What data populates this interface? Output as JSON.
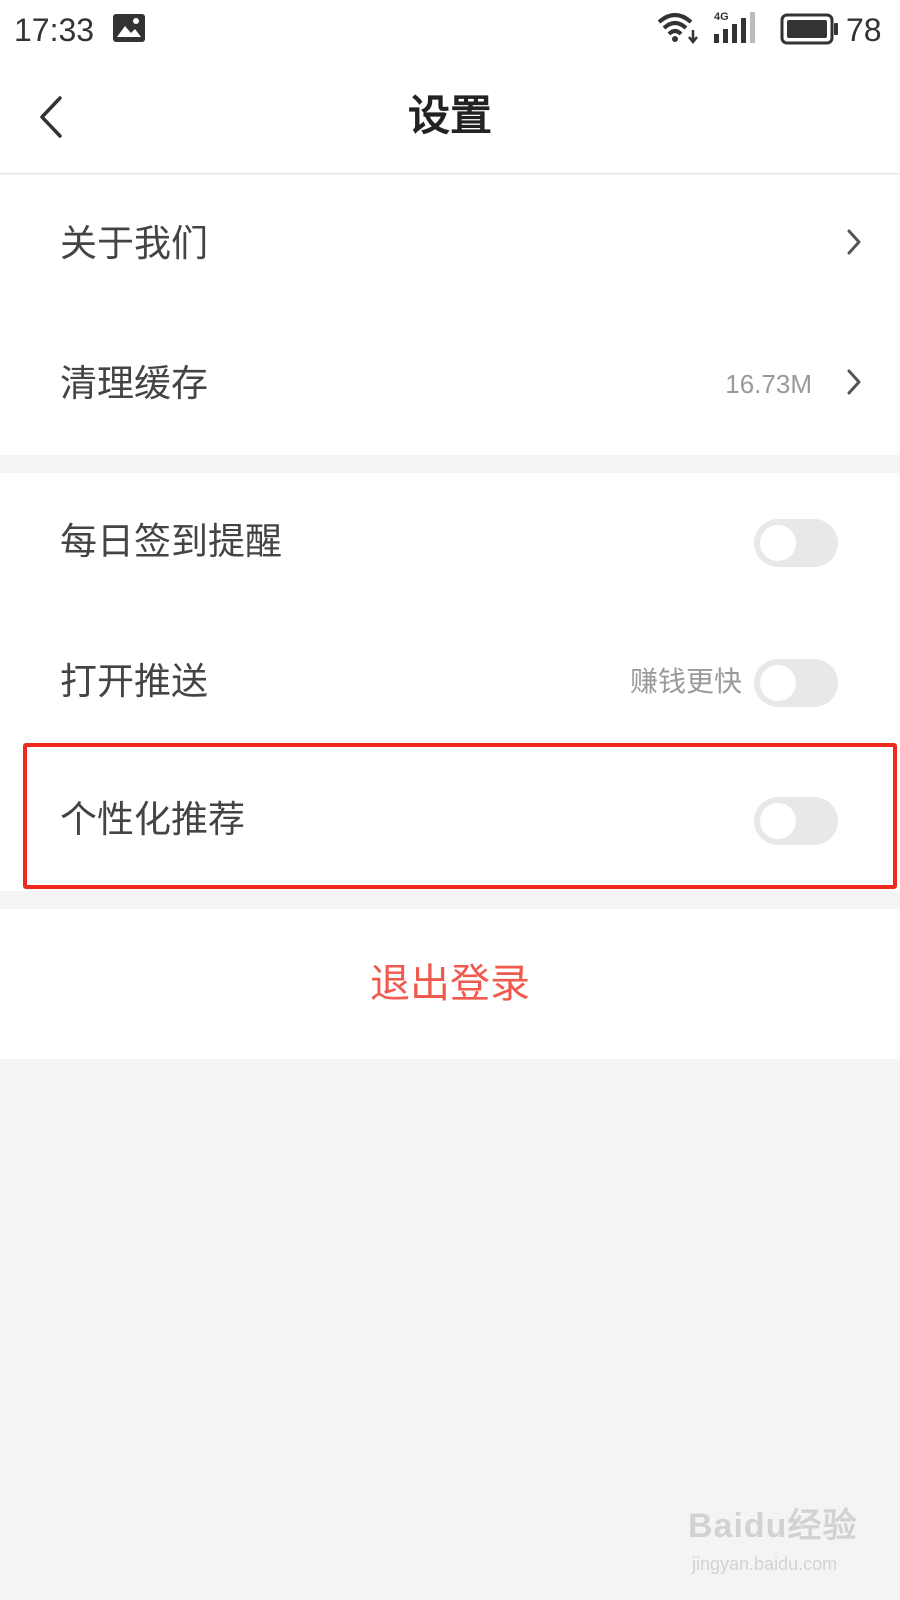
{
  "status_bar": {
    "time": "17:33",
    "battery_level": "78",
    "network": "4G",
    "icons": [
      "picture-icon",
      "wifi-icon",
      "signal-icon",
      "battery-icon"
    ]
  },
  "header": {
    "title": "设置",
    "back_icon": "back-arrow-icon"
  },
  "settings": {
    "about": {
      "label": "关于我们"
    },
    "clear_cache": {
      "label": "清理缓存",
      "value": "16.73M"
    },
    "checkin_reminder": {
      "label": "每日签到提醒",
      "enabled": false
    },
    "push": {
      "label": "打开推送",
      "hint": "赚钱更快",
      "enabled": false
    },
    "personalized": {
      "label": "个性化推荐",
      "enabled": false
    }
  },
  "logout": {
    "label": "退出登录"
  },
  "watermark": {
    "brand": "Baidu经验",
    "sub": "jingyan.baidu.com"
  },
  "colors": {
    "accent_red": "#f05a4e",
    "highlight_border": "#f02a1f",
    "page_bg": "#f4f4f4",
    "toggle_off": "#e6e8ea"
  }
}
